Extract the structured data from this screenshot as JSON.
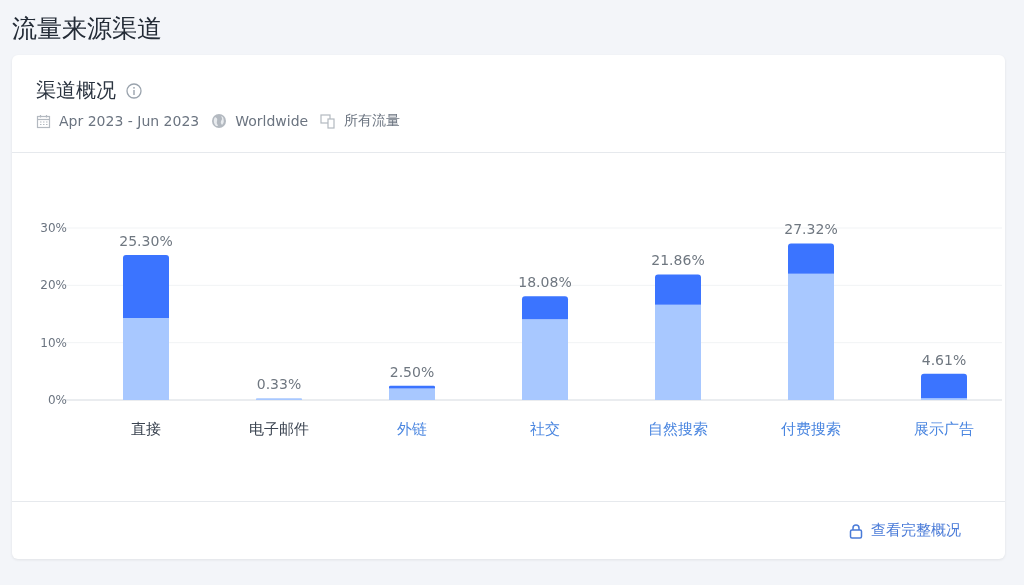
{
  "page_title": "流量来源渠道",
  "card": {
    "title": "渠道概况",
    "filters": [
      {
        "kind": "date",
        "text": "Apr 2023 - Jun 2023"
      },
      {
        "kind": "region",
        "text": "Worldwide"
      },
      {
        "kind": "traffic",
        "text": "所有流量"
      }
    ],
    "chart_data": {
      "type": "bar",
      "stacked": true,
      "categories": [
        "直接",
        "电子邮件",
        "外链",
        "社交",
        "自然搜索",
        "付费搜索",
        "展示广告"
      ],
      "series": [
        {
          "color": "#a8c8ff",
          "values": [
            14.3,
            0.3,
            2.0,
            14.1,
            16.6,
            22.0,
            0.3
          ]
        },
        {
          "color": "#3b74ff",
          "values": [
            11.0,
            0,
            0.5,
            4.0,
            5.3,
            5.3,
            4.3
          ]
        }
      ],
      "value_labels": [
        "25.30%",
        "0.33%",
        "2.50%",
        "18.08%",
        "21.86%",
        "27.32%",
        "4.61%"
      ],
      "ylim": [
        0,
        30
      ],
      "yticks": [
        {
          "value": 0,
          "label": "0%"
        },
        {
          "value": 10,
          "label": "10%"
        },
        {
          "value": 20,
          "label": "20%"
        },
        {
          "value": 30,
          "label": "30%"
        }
      ]
    },
    "category_links": [
      false,
      false,
      true,
      true,
      true,
      true,
      true
    ],
    "footer_link": "查看完整概况"
  }
}
